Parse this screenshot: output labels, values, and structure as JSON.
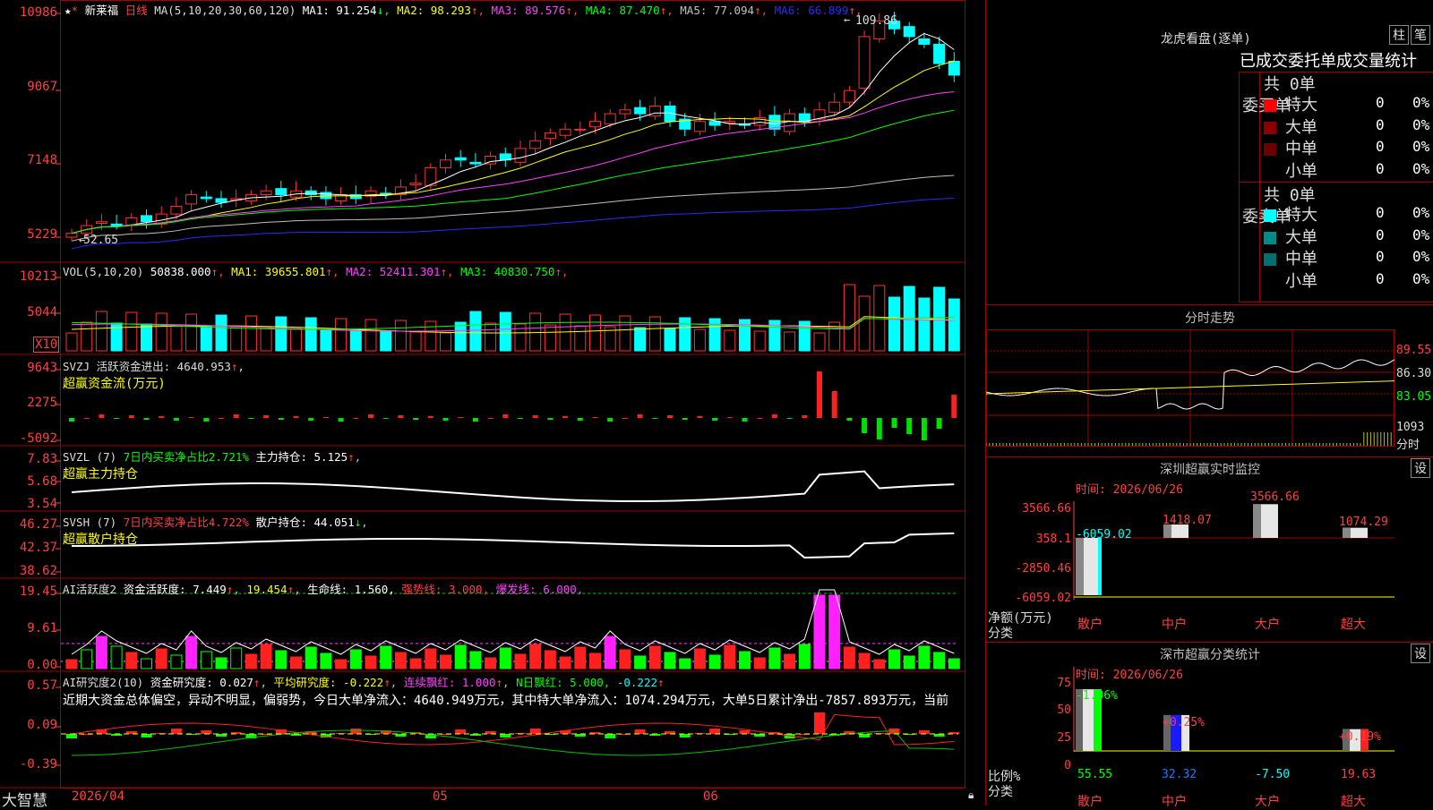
{
  "stock": {
    "name": "新莱福",
    "period": "日线",
    "ma_header": "MA(5,10,20,30,60,120)",
    "ma_values": [
      {
        "label": "MA1:",
        "value": "91.254",
        "arrow": "↓",
        "color": "#ffffff"
      },
      {
        "label": "MA2:",
        "value": "98.293",
        "arrow": "↑",
        "color": "#ffff00"
      },
      {
        "label": "MA3:",
        "value": "89.576",
        "arrow": "↑",
        "color": "#ff40ff"
      },
      {
        "label": "MA4:",
        "value": "87.470",
        "arrow": "↑",
        "color": "#00ff00"
      },
      {
        "label": "MA5:",
        "value": "77.094",
        "arrow": "↑",
        "color": "#c0c0c0"
      },
      {
        "label": "MA6:",
        "value": "66.899",
        "arrow": "↑",
        "color": "#2a2aff"
      }
    ],
    "high_marker": "109.86",
    "low_marker": "52.65"
  },
  "price_axis": [
    "10986",
    "9067",
    "7148",
    "5229"
  ],
  "vol": {
    "header": "VOL(5,10,20)",
    "value": "50838.000",
    "ma": [
      {
        "label": "MA1:",
        "value": "39655.801",
        "color": "#ffff00"
      },
      {
        "label": "MA2:",
        "value": "52411.301",
        "color": "#ff40ff"
      },
      {
        "label": "MA3:",
        "value": "40830.750",
        "color": "#00ff00"
      }
    ],
    "axis": [
      "10213",
      "5044"
    ],
    "unit": "X10"
  },
  "svzj": {
    "line1": "SVZJ  活跃资金进出: 4640.953",
    "line2": "超赢资金流(万元)",
    "axis": [
      "9643",
      "2275",
      "-5092"
    ]
  },
  "svzl": {
    "prefix": "SVZL (7)",
    "mid": "7日内买卖净占比2.721%",
    "main": "主力持仓: 5.125",
    "line2": "超赢主力持仓",
    "axis": [
      "7.83",
      "5.68",
      "3.54"
    ]
  },
  "svsh": {
    "prefix": "SVSH (7)",
    "mid": "7日内买卖净占比4.722%",
    "main": "散户持仓: 44.051",
    "line2": "超赢散户持仓",
    "axis": [
      "46.27",
      "42.37",
      "38.62"
    ]
  },
  "ai1": {
    "prefix": "AI活跃度2",
    "label": "资金活跃度: 7.449",
    "v2": "19.454",
    "life": "生命线: 1.560,",
    "strong": "强势线: 3.000,",
    "burst": "爆发线: 6.000,",
    "axis": [
      "19.45",
      "9.61",
      "0.00"
    ]
  },
  "ai2": {
    "prefix": "AI研究度2(10)",
    "label": "资金研究度: 0.027",
    "avg": "平均研究度: -0.222",
    "red": "连续飘红: 1.000",
    "nred": "N日飘红: 5.000,",
    "extra": "-0.222",
    "desc": "近期大资金总体偏空，异动不明显，偏弱势，今日大单净流入：4640.949万元，其中特大单净流入：1074.294万元，大单5日累计净出-7857.893万元，当前",
    "axis": [
      "0.57",
      "0.09",
      "-0.39"
    ]
  },
  "date_axis": [
    "2026/04",
    "05",
    "06"
  ],
  "brand": "大智慧",
  "right": {
    "lhb_title": "龙虎看盘(逐单)",
    "btn_zhu": "柱",
    "btn_bi": "笔",
    "tabs_row": "已成交委托单成交量统计",
    "buy_label": "委买单",
    "sell_label": "委卖单",
    "buy_total": "共 0单",
    "sell_total": "共 0单",
    "buy_rows": [
      {
        "name": "特大",
        "count": "0",
        "pct": "0%",
        "color": "#ff0000"
      },
      {
        "name": "大单",
        "count": "0",
        "pct": "0%",
        "color": "#8b0000"
      },
      {
        "name": "中单",
        "count": "0",
        "pct": "0%",
        "color": "#6a0000"
      },
      {
        "name": "小单",
        "count": "0",
        "pct": "0%",
        "color": "#000000"
      }
    ],
    "sell_rows": [
      {
        "name": "特大",
        "count": "0",
        "pct": "0%",
        "color": "#00ffff"
      },
      {
        "name": "大单",
        "count": "0",
        "pct": "0%",
        "color": "#008b8b"
      },
      {
        "name": "中单",
        "count": "0",
        "pct": "0%",
        "color": "#007070"
      },
      {
        "name": "小单",
        "count": "0",
        "pct": "0%",
        "color": "#000000"
      }
    ],
    "intraday_title": "分时走势",
    "intraday_axis": [
      "89.55",
      "86.30",
      "83.05",
      "1093",
      "分时"
    ],
    "sz_title": "深圳超赢实时监控",
    "sz_btn": "设",
    "sz_date": "时间: 2026/06/26",
    "sz_axis": [
      "3566.66",
      "358.1",
      "-2850.46",
      "-6059.02"
    ],
    "sz_yname": "净额(万元)",
    "sz_xname": "分类",
    "sz_bars": [
      {
        "cat": "散户",
        "value": "-6059.02"
      },
      {
        "cat": "中户",
        "value": "1418.07"
      },
      {
        "cat": "大户",
        "value": "3566.66"
      },
      {
        "cat": "超大",
        "value": "1074.29"
      }
    ],
    "ss_title": "深市超赢分类统计",
    "ss_btn": "设",
    "ss_date": "时间: 2026/06/26",
    "ss_axis": [
      "75",
      "50",
      "25",
      "0"
    ],
    "ss_yname": "比例%",
    "ss_xname": "分类",
    "ss_bars": [
      {
        "cat": "散户",
        "top": "-1.06%",
        "bottom": "55.55"
      },
      {
        "cat": "中户",
        "top": "+0.25%",
        "bottom": "32.32"
      },
      {
        "cat": "大户",
        "top": "",
        "bottom": "-7.50"
      },
      {
        "cat": "超大",
        "top": "+0.19%",
        "bottom": "19.63"
      }
    ]
  },
  "colors": {
    "up": "#ff3030",
    "down": "#00ffff",
    "grid": "#a00000",
    "axis_text": "#ff4040"
  }
}
